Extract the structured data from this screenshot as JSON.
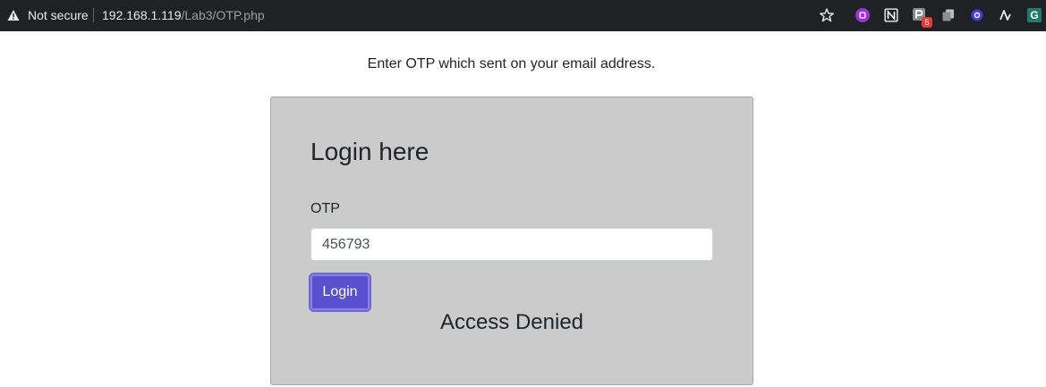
{
  "browser": {
    "security_label": "Not secure",
    "url_host": "192.168.1.119",
    "url_path": "/Lab3/OTP.php",
    "extensions": [
      {
        "icon": "purple-circle-extension-icon"
      },
      {
        "icon": "notion-extension-icon"
      },
      {
        "icon": "p-extension-icon",
        "badge": "5"
      },
      {
        "icon": "copy-extension-icon"
      },
      {
        "icon": "blue-ring-extension-icon"
      },
      {
        "icon": "wave-extension-icon"
      },
      {
        "icon": "g-extension-icon",
        "letter": "G"
      }
    ]
  },
  "page": {
    "prompt": "Enter OTP which sent on your email address.",
    "card": {
      "title": "Login here",
      "otp_label": "OTP",
      "otp_value": "456793",
      "login_label": "Login",
      "status_message": "Access Denied"
    }
  },
  "colors": {
    "topbar": "#202124",
    "card_bg": "#cbcbcb",
    "button": "#5a4fcf"
  }
}
